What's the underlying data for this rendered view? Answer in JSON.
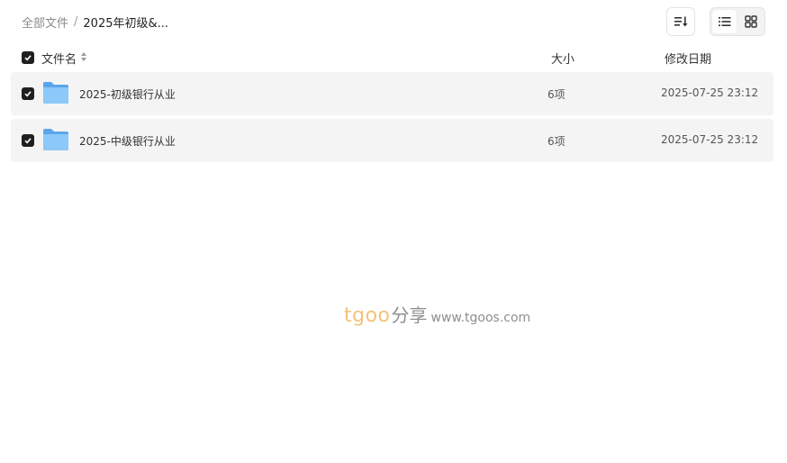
{
  "breadcrumb": {
    "root": "全部文件",
    "separator": "/",
    "current": "2025年初级&..."
  },
  "toolbar": {
    "sort_icon": "sort-list-icon",
    "view_list_icon": "list-view-icon",
    "view_grid_icon": "grid-view-icon",
    "active_view": "list"
  },
  "table": {
    "columns": {
      "name": "文件名",
      "size": "大小",
      "date": "修改日期"
    },
    "rows": [
      {
        "name": "2025-初级银行从业",
        "size": "6项",
        "date": "2025-07-25 23:12",
        "checked": true,
        "icon": "folder-icon"
      },
      {
        "name": "2025-中级银行从业",
        "size": "6项",
        "date": "2025-07-25 23:12",
        "checked": true,
        "icon": "folder-icon"
      }
    ]
  },
  "watermark": {
    "brand_a": "tgoo",
    "brand_cn": "分享",
    "url": "www.tgoos.com"
  },
  "colors": {
    "checkbox": "#1f1f1f",
    "row_bg": "#f4f4f4",
    "folder": "#6cb4f2"
  }
}
